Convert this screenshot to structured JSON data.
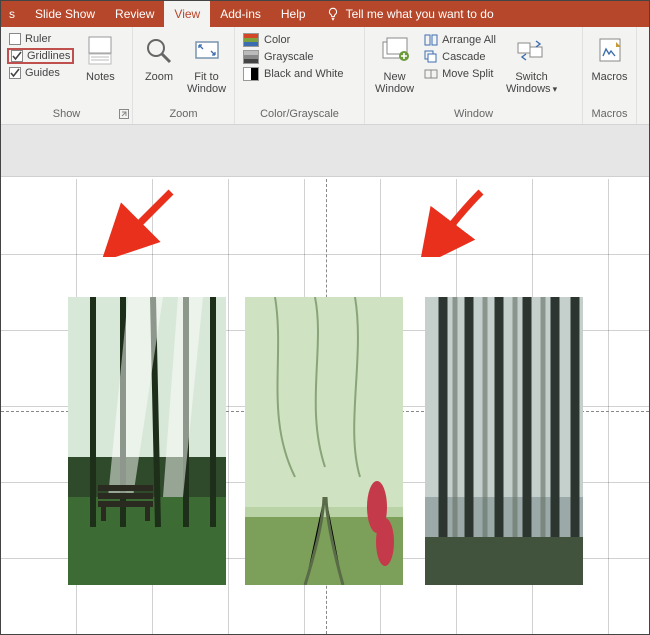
{
  "colors": {
    "accent": "#b7472a"
  },
  "tabs": {
    "items": [
      "Slide Show",
      "Review",
      "View",
      "Add-ins",
      "Help"
    ],
    "active_index": 2,
    "search_prompt": "Tell me what you want to do"
  },
  "ribbon": {
    "show": {
      "label": "Show",
      "ruler": {
        "label": "Ruler",
        "checked": false
      },
      "gridlines": {
        "label": "Gridlines",
        "checked": true
      },
      "guides": {
        "label": "Guides",
        "checked": true
      },
      "notes_label": "Notes"
    },
    "zoom": {
      "label": "Zoom",
      "zoom_label": "Zoom",
      "fit_label_line1": "Fit to",
      "fit_label_line2": "Window"
    },
    "colorgray": {
      "label": "Color/Grayscale",
      "color_label": "Color",
      "gray_label": "Grayscale",
      "bw_label": "Black and White"
    },
    "window": {
      "label": "Window",
      "new_label_line1": "New",
      "new_label_line2": "Window",
      "arrange_label": "Arrange All",
      "cascade_label": "Cascade",
      "movesplit_label": "Move Split",
      "switch_label_line1": "Switch",
      "switch_label_line2": "Windows"
    },
    "macros": {
      "label": "Macros",
      "btn_label": "Macros"
    }
  },
  "canvas": {
    "images": [
      {
        "name": "park-bench-photo"
      },
      {
        "name": "foggy-track-photo"
      },
      {
        "name": "misty-forest-photo"
      }
    ]
  }
}
